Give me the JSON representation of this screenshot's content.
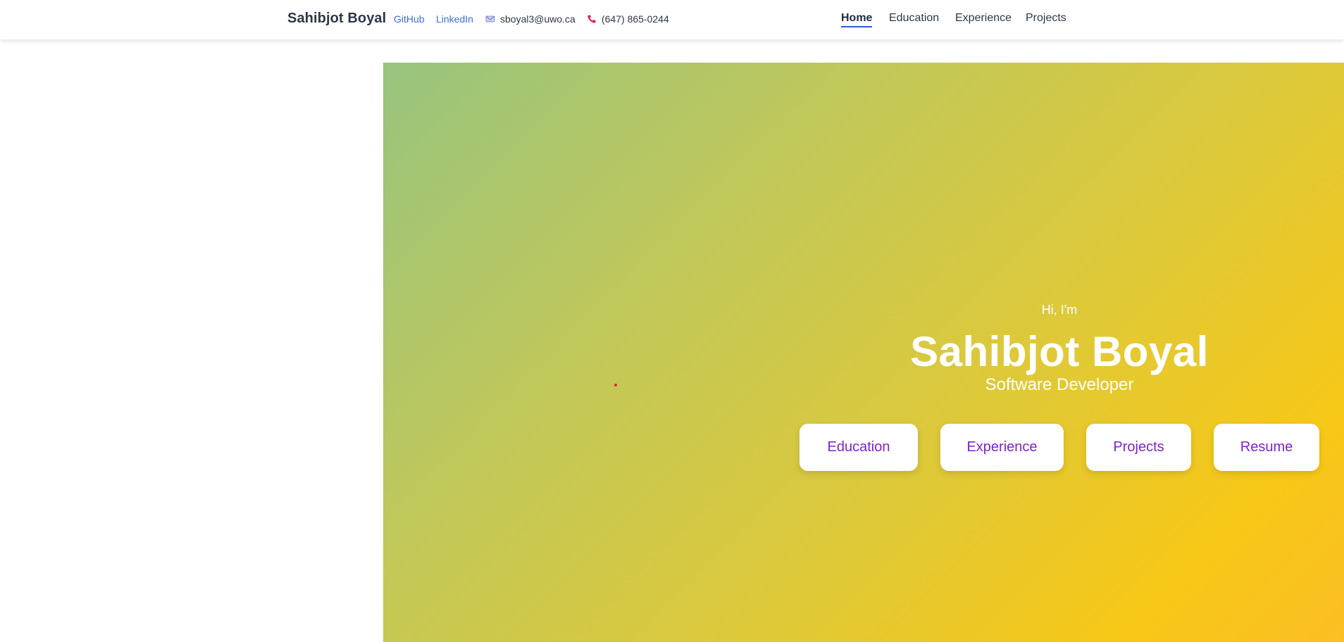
{
  "navbar": {
    "brand": "Sahibjot Boyal",
    "links": {
      "github": "GitHub",
      "linkedin": "LinkedIn"
    },
    "contact": {
      "email": "sboyal3@uwo.ca",
      "email_icon": "envelope-icon",
      "phone": "(647) 865-0244",
      "phone_icon": "phone-icon"
    },
    "menu": {
      "home": "Home",
      "education": "Education",
      "experience": "Experience",
      "projects": "Projects",
      "active": "Home"
    }
  },
  "hero": {
    "greeting": "Hi, I'm",
    "name": "Sahibjot Boyal",
    "role": "Software Developer",
    "buttons": {
      "education": "Education",
      "experience": "Experience",
      "projects": "Projects",
      "resume": "Resume"
    }
  },
  "colors": {
    "accent_blue": "#3b6fd8",
    "button_text": "#7e22ce",
    "gradient_start": "#98c47f",
    "gradient_end": "#fbbf24"
  }
}
